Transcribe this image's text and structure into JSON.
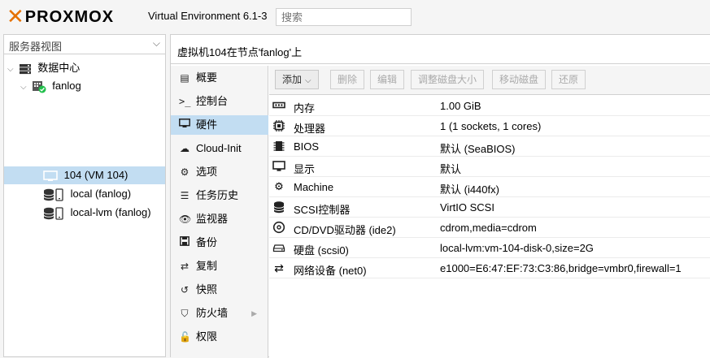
{
  "header": {
    "logo_text": "PROXMOX",
    "version": "Virtual Environment 6.1-3",
    "search_placeholder": "搜索"
  },
  "left_panel": {
    "view_selector": "服务器视图",
    "tree": {
      "datacenter": "数据中心",
      "node": "fanlog",
      "vm": "104 (VM 104)",
      "storages": [
        "local (fanlog)",
        "local-lvm (fanlog)"
      ]
    }
  },
  "main": {
    "title": "虚拟机104在节点'fanlog'上",
    "nav": [
      {
        "label": "概要",
        "icon": "book-icon"
      },
      {
        "label": "控制台",
        "icon": "terminal-icon"
      },
      {
        "label": "硬件",
        "icon": "desktop-icon",
        "selected": true
      },
      {
        "label": "Cloud-Init",
        "icon": "cloud-icon"
      },
      {
        "label": "选项",
        "icon": "gear-icon"
      },
      {
        "label": "任务历史",
        "icon": "list-icon"
      },
      {
        "label": "监视器",
        "icon": "eye-icon"
      },
      {
        "label": "备份",
        "icon": "floppy-icon"
      },
      {
        "label": "复制",
        "icon": "retweet-icon"
      },
      {
        "label": "快照",
        "icon": "history-icon"
      },
      {
        "label": "防火墙",
        "icon": "shield-icon"
      },
      {
        "label": "权限",
        "icon": "unlock-icon"
      }
    ],
    "toolbar": {
      "add": "添加",
      "remove": "删除",
      "edit": "编辑",
      "resize_disk": "调整磁盘大小",
      "move_disk": "移动磁盘",
      "revert": "还原"
    },
    "hardware": [
      {
        "key": "内存",
        "value": "1.00 GiB",
        "icon": "memory-icon"
      },
      {
        "key": "处理器",
        "value": "1 (1 sockets, 1 cores)",
        "icon": "cpu-icon"
      },
      {
        "key": "BIOS",
        "value": "默认 (SeaBIOS)",
        "icon": "microchip-icon"
      },
      {
        "key": "显示",
        "value": "默认",
        "icon": "monitor-icon"
      },
      {
        "key": "Machine",
        "value": "默认 (i440fx)",
        "icon": "cogs-icon"
      },
      {
        "key": "SCSI控制器",
        "value": "VirtIO SCSI",
        "icon": "database-icon"
      },
      {
        "key": "CD/DVD驱动器 (ide2)",
        "value": "cdrom,media=cdrom",
        "icon": "cdrom-icon"
      },
      {
        "key": "硬盘 (scsi0)",
        "value": "local-lvm:vm-104-disk-0,size=2G",
        "icon": "hdd-icon"
      },
      {
        "key": "网络设备 (net0)",
        "value": "e1000=E6:47:EF:73:C3:86,bridge=vmbr0,firewall=1",
        "icon": "exchange-icon"
      }
    ]
  },
  "colors": {
    "accent": "#e57000",
    "selection": "#c2ddf2",
    "panel_bg": "#f5f5f5"
  }
}
